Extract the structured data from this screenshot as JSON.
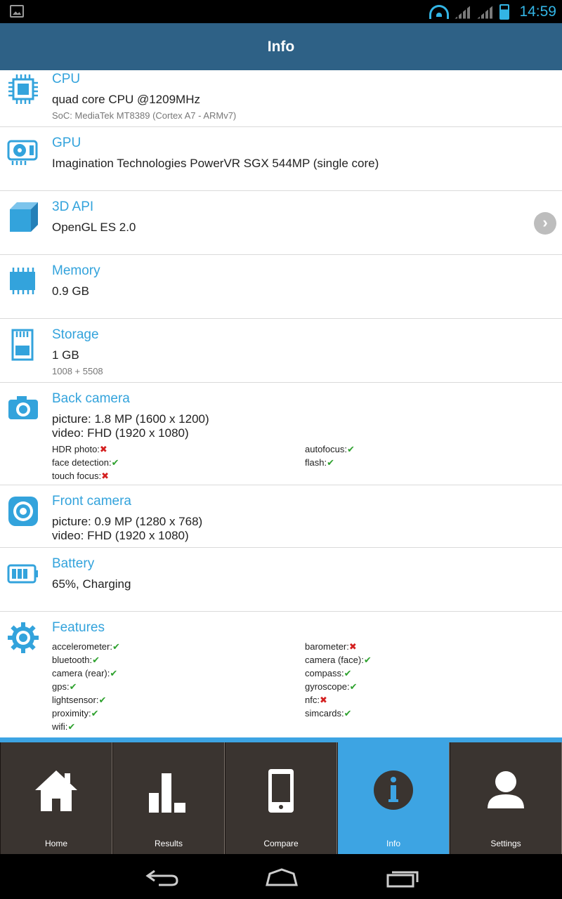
{
  "statusbar": {
    "time": "14:59",
    "icons": [
      "image-notification-icon",
      "wifi-icon",
      "signal-icon",
      "signal-icon",
      "battery-charging-icon"
    ]
  },
  "appbar": {
    "title": "Info"
  },
  "sections": {
    "cpu": {
      "title": "CPU",
      "main": "quad core CPU @1209MHz",
      "sub": "SoC: MediaTek MT8389 (Cortex A7 - ARMv7)",
      "icon": "cpu-icon"
    },
    "gpu": {
      "title": "GPU",
      "main": "Imagination Technologies PowerVR SGX 544MP (single core)",
      "icon": "gpu-icon"
    },
    "api": {
      "title": "3D API",
      "main": "OpenGL ES 2.0",
      "icon": "cube-icon"
    },
    "memory": {
      "title": "Memory",
      "main": "0.9 GB",
      "icon": "memory-chip-icon"
    },
    "storage": {
      "title": "Storage",
      "main": "1 GB",
      "sub": "1008 + 5508",
      "icon": "sd-card-icon"
    },
    "back_camera": {
      "title": "Back camera",
      "main1": "picture: 1.8 MP (1600 x 1200)",
      "main2": "video: FHD (1920 x 1080)",
      "flags": [
        {
          "label": "HDR photo:",
          "mark": "✖",
          "ok": false
        },
        {
          "label": "autofocus:",
          "mark": "✔",
          "ok": true
        },
        {
          "label": "face detection:",
          "mark": "✔",
          "ok": true
        },
        {
          "label": "flash:",
          "mark": "✔",
          "ok": true
        },
        {
          "label": "touch focus:",
          "mark": "✖",
          "ok": false
        }
      ],
      "icon": "camera-icon"
    },
    "front_camera": {
      "title": "Front camera",
      "main1": "picture: 0.9 MP (1280 x 768)",
      "main2": "video: FHD (1920 x 1080)",
      "icon": "front-camera-icon"
    },
    "battery": {
      "title": "Battery",
      "main": "65%, Charging",
      "icon": "battery-icon"
    },
    "features": {
      "title": "Features",
      "flags": [
        {
          "label": "accelerometer:",
          "mark": "✔",
          "ok": true
        },
        {
          "label": "barometer:",
          "mark": "✖",
          "ok": false
        },
        {
          "label": "bluetooth:",
          "mark": "✔",
          "ok": true
        },
        {
          "label": "camera (face):",
          "mark": "✔",
          "ok": true
        },
        {
          "label": "camera (rear):",
          "mark": "✔",
          "ok": true
        },
        {
          "label": "compass:",
          "mark": "✔",
          "ok": true
        },
        {
          "label": "gps:",
          "mark": "✔",
          "ok": true
        },
        {
          "label": "gyroscope:",
          "mark": "✔",
          "ok": true
        },
        {
          "label": "lightsensor:",
          "mark": "✔",
          "ok": true
        },
        {
          "label": "nfc:",
          "mark": "✖",
          "ok": false
        },
        {
          "label": "proximity:",
          "mark": "✔",
          "ok": true
        },
        {
          "label": "simcards:",
          "mark": "✔",
          "ok": true
        },
        {
          "label": "wifi:",
          "mark": "✔",
          "ok": true
        }
      ],
      "icon": "gear-icon"
    }
  },
  "tabs": [
    {
      "label": "Home",
      "icon": "home-icon"
    },
    {
      "label": "Results",
      "icon": "bar-chart-icon"
    },
    {
      "label": "Compare",
      "icon": "phone-icon"
    },
    {
      "label": "Info",
      "icon": "info-icon",
      "active": true
    },
    {
      "label": "Settings",
      "icon": "user-icon"
    }
  ],
  "navbar": {
    "icons": [
      "back-icon",
      "home-nav-icon",
      "recents-icon"
    ]
  },
  "colors": {
    "accent": "#33a3dc",
    "appbar": "#2e6186",
    "tab_active": "#3da4e3",
    "tab_bg": "#3a3430",
    "ok": "#2ea12e",
    "no": "#d42020"
  }
}
